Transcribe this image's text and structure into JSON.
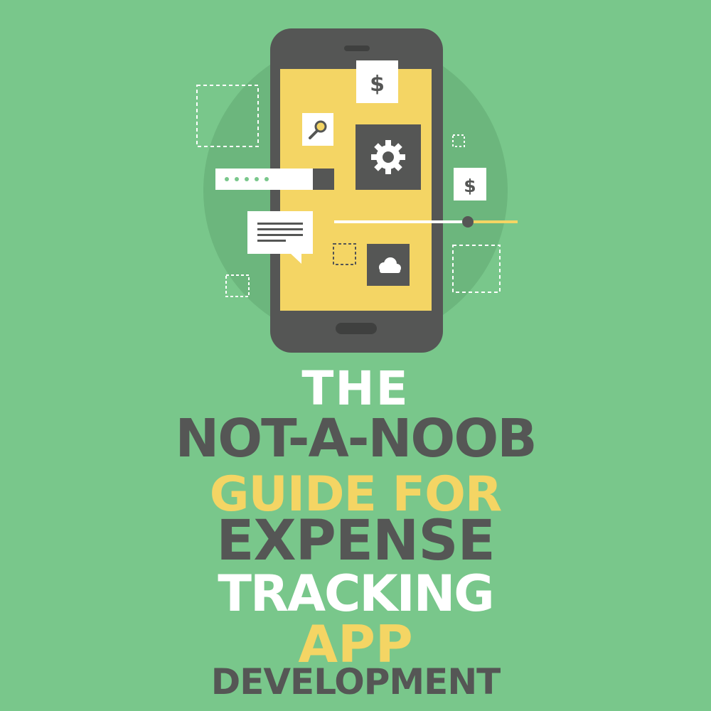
{
  "colors": {
    "background": "#79c78b",
    "halo": "#6cb67d",
    "phone_body": "#555655",
    "phone_screen": "#f4d564",
    "white": "#ffffff",
    "dark": "#555655",
    "yellow": "#f4d564"
  },
  "icons": {
    "dollar_top": "dollar-icon",
    "dollar_right": "dollar-icon",
    "search": "magnifier-icon",
    "settings": "gear-icon",
    "chat": "speech-bubble-icon",
    "cloud": "cloud-icon",
    "password": "password-field-icon",
    "slider": "slider-icon"
  },
  "glyphs": {
    "dollar": "$"
  },
  "title": {
    "line1": {
      "text": "THE",
      "color": "#ffffff"
    },
    "line2": {
      "text": "NOT-A-NOOB",
      "color": "#555655"
    },
    "line3": {
      "text": "GUIDE FOR",
      "color": "#f4d564"
    },
    "line4": {
      "text": "EXPENSE",
      "color": "#555655"
    },
    "line5": {
      "text": "TRACKING",
      "color": "#ffffff"
    },
    "line6": {
      "text": "APP",
      "color": "#f4d564"
    },
    "line7": {
      "text": "DEVELOPMENT",
      "color": "#555655"
    }
  }
}
